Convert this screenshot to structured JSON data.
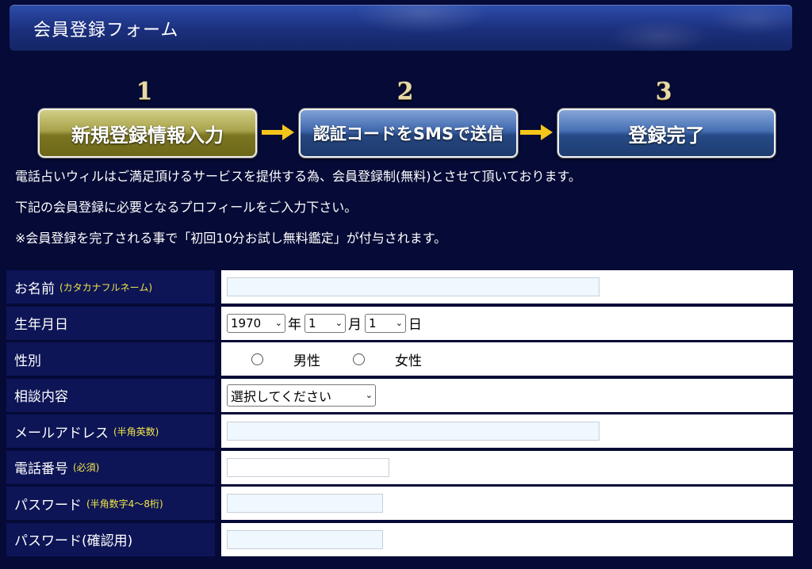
{
  "header": {
    "title": "会員登録フォーム"
  },
  "steps": [
    {
      "number": "1",
      "label": "新規登録情報入力"
    },
    {
      "number": "2",
      "label": "認証コードをSMSで送信"
    },
    {
      "number": "3",
      "label": "登録完了"
    }
  ],
  "intro": {
    "line1": "電話占いウィルはご満足頂けるサービスを提供する為、会員登録制(無料)とさせて頂いております。",
    "line2": "下記の会員登録に必要となるプロフィールをご入力下さい。",
    "line3": "※会員登録を完了される事で「初回10分お試し無料鑑定」が付与されます。"
  },
  "form": {
    "name": {
      "label": "お名前",
      "note": "(カタカナフルネーム)",
      "value": ""
    },
    "birthdate": {
      "label": "生年月日",
      "year": "1970",
      "year_unit": "年",
      "month": "1",
      "month_unit": "月",
      "day": "1",
      "day_unit": "日"
    },
    "gender": {
      "label": "性別",
      "option_male": "男性",
      "option_female": "女性"
    },
    "consultation": {
      "label": "相談内容",
      "selected": "選択してください"
    },
    "email": {
      "label": "メールアドレス",
      "note": "(半角英数)",
      "value": ""
    },
    "phone": {
      "label": "電話番号",
      "note": "(必須)",
      "value": ""
    },
    "password": {
      "label": "パスワード",
      "note": "(半角数字4〜8桁)",
      "value": ""
    },
    "password_confirm": {
      "label": "パスワード(確認用)",
      "value": ""
    }
  },
  "colors": {
    "background": "#050a36",
    "label_bg": "#0d1556",
    "note": "#f2e64a",
    "step_active": "#a7a24a",
    "step_inactive": "#3f67ad"
  }
}
